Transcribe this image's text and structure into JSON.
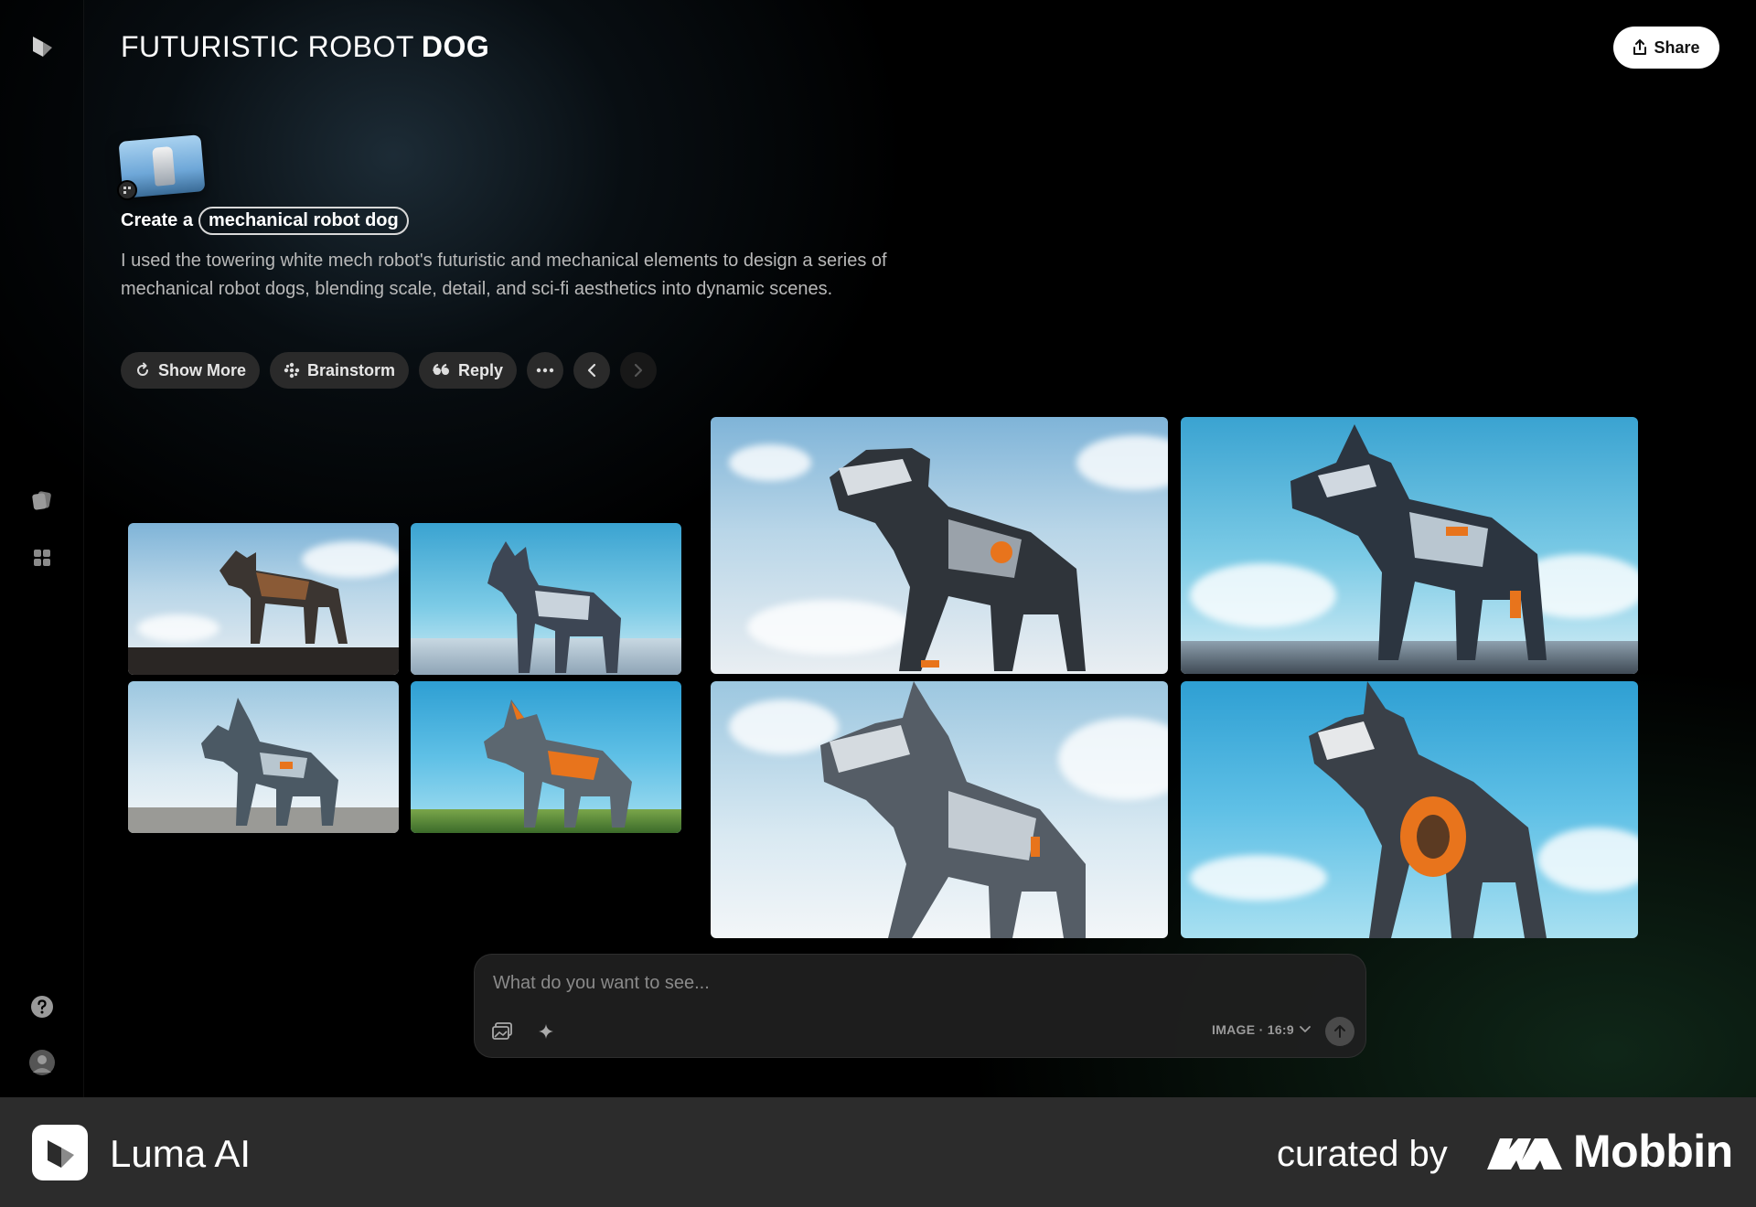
{
  "header": {
    "title_light": "FUTURISTIC ROBOT",
    "title_bold": "DOG",
    "share_label": "Share"
  },
  "prompt": {
    "prefix": "Create a",
    "highlight": "mechanical robot dog",
    "description": "I used the towering white mech robot's futuristic and mechanical elements to design a series of mechanical robot dogs, blending scale, detail, and sci-fi aesthetics into dynamic scenes."
  },
  "actions": {
    "show_more": "Show More",
    "brainstorm": "Brainstorm",
    "reply": "Reply"
  },
  "composer": {
    "placeholder": "What do you want to see...",
    "mode": "IMAGE · 16:9"
  },
  "footer": {
    "app_name": "Luma AI",
    "curated": "curated by",
    "brand": "Mobbin"
  },
  "colors": {
    "background": "#000000",
    "panel": "#202020",
    "button": "#2a2a2a",
    "footer": "#2c2c2c",
    "accent_orange": "#e8741c"
  }
}
